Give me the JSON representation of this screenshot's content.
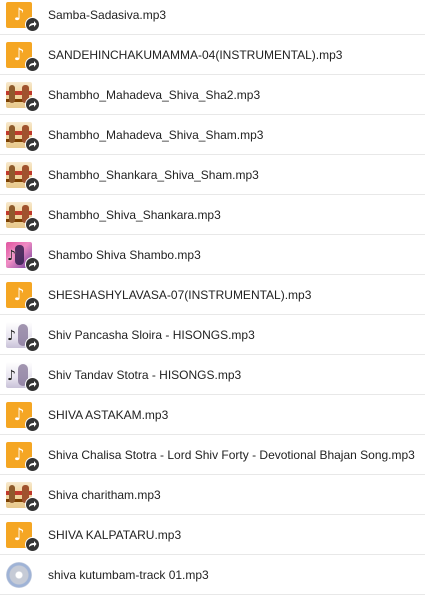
{
  "files": [
    {
      "name": "Samba-Sadasiva.mp3",
      "icon": "audio-file-icon"
    },
    {
      "name": "SANDEHINCHAKUMAMMA-04(INSTRUMENTAL).mp3",
      "icon": "audio-file-icon"
    },
    {
      "name": "Shambho_Mahadeva_Shiva_Sha2.mp3",
      "icon": "album-art-icon"
    },
    {
      "name": "Shambho_Mahadeva_Shiva_Sham.mp3",
      "icon": "album-art-icon"
    },
    {
      "name": "Shambho_Shankara_Shiva_Sham.mp3",
      "icon": "album-art-icon"
    },
    {
      "name": "Shambho_Shiva_Shankara.mp3",
      "icon": "album-art-icon"
    },
    {
      "name": "Shambo Shiva Shambo.mp3",
      "icon": "album-art-icon"
    },
    {
      "name": "SHESHASHYLAVASA-07(INSTRUMENTAL).mp3",
      "icon": "audio-file-icon"
    },
    {
      "name": "Shiv Pancasha Sloira - HISONGS.mp3",
      "icon": "album-art-icon"
    },
    {
      "name": "Shiv Tandav Stotra - HISONGS.mp3",
      "icon": "album-art-icon"
    },
    {
      "name": "SHIVA ASTAKAM.mp3",
      "icon": "audio-file-icon"
    },
    {
      "name": "Shiva Chalisa Stotra - Lord Shiv Forty - Devotional Bhajan Song.mp3",
      "icon": "audio-file-icon"
    },
    {
      "name": "Shiva charitham.mp3",
      "icon": "album-art-icon"
    },
    {
      "name": "SHIVA KALPATARU.mp3",
      "icon": "audio-file-icon"
    },
    {
      "name": "shiva kutumbam-track 01.mp3",
      "icon": "album-art-icon"
    }
  ],
  "glyphs": {
    "note": "♪"
  },
  "colors": {
    "audio_icon": "#f5a623",
    "share_badge": "#333333",
    "divider": "#e8e8e8"
  }
}
